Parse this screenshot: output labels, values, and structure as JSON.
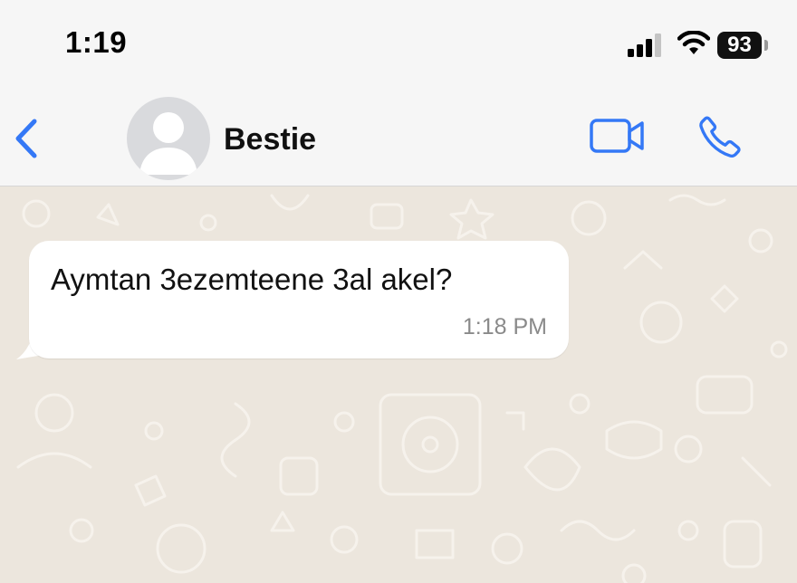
{
  "status_bar": {
    "time": "1:19",
    "battery": "93",
    "signal_icon": "cellular-signal-icon",
    "wifi_icon": "wifi-icon",
    "battery_icon": "battery-icon"
  },
  "header": {
    "contact_name": "Bestie",
    "back_icon": "chevron-left-icon",
    "avatar_icon": "default-avatar-icon",
    "video_icon": "video-camera-icon",
    "call_icon": "phone-icon",
    "accent_color": "#3478f6"
  },
  "chat": {
    "wallpaper_color": "#ece6dd",
    "messages": [
      {
        "text": "Aymtan 3ezemteene 3al akel?",
        "time": "1:18 PM"
      }
    ]
  }
}
